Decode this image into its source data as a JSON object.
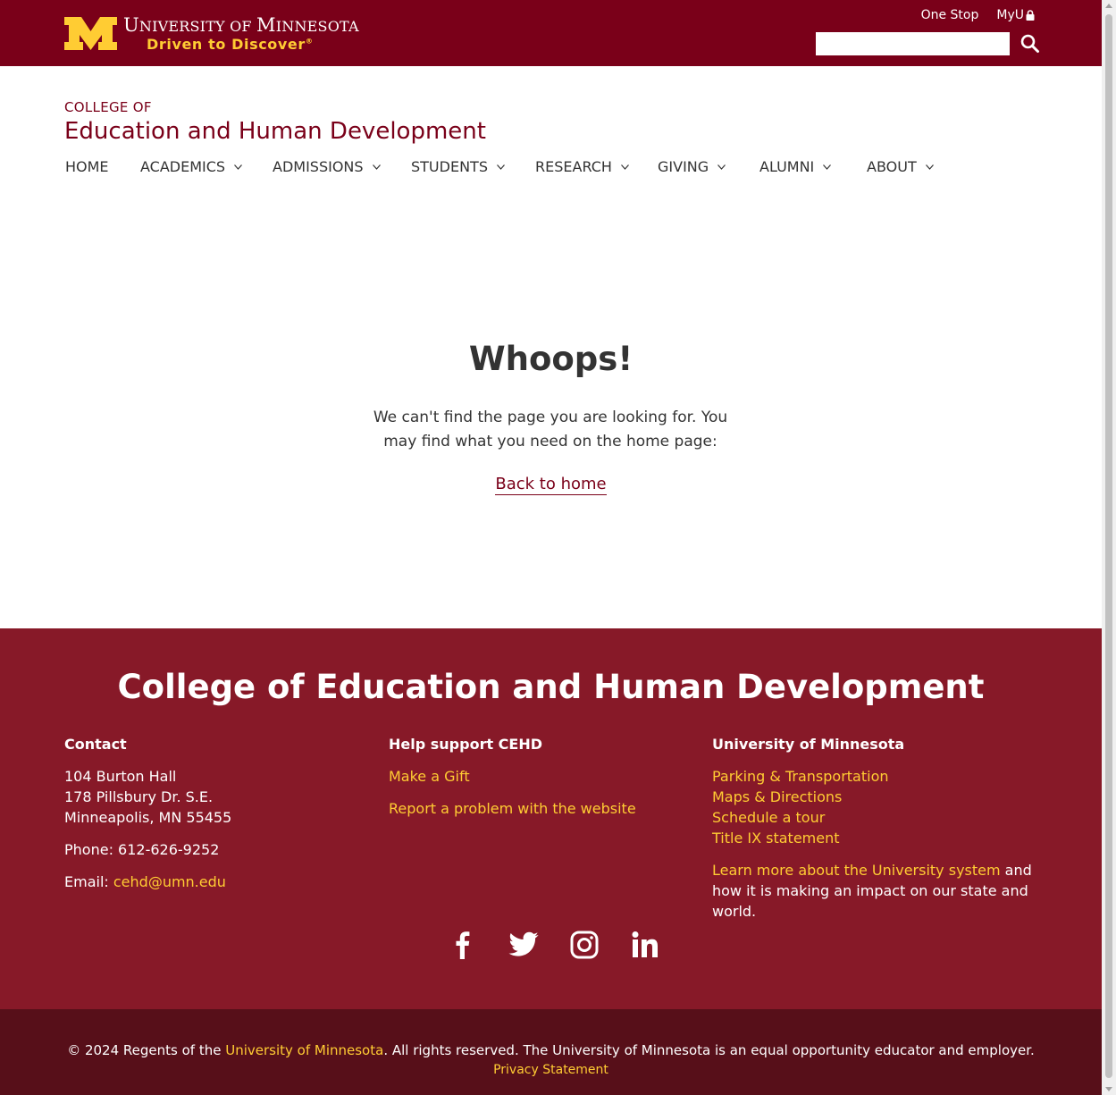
{
  "header": {
    "university_name": "UNIVERSITY OF MINNESOTA",
    "university_name_display": "University of Minnesota",
    "tagline": "Driven to Discover",
    "tagline_mark": "®",
    "links": {
      "one_stop": "One Stop",
      "myu": "MyU"
    },
    "search": {
      "placeholder": ""
    }
  },
  "college": {
    "prefix": "COLLEGE OF",
    "name": "Education and Human Development"
  },
  "nav": [
    {
      "label": "HOME",
      "has_menu": false
    },
    {
      "label": "ACADEMICS",
      "has_menu": true
    },
    {
      "label": "ADMISSIONS",
      "has_menu": true
    },
    {
      "label": "STUDENTS",
      "has_menu": true
    },
    {
      "label": "RESEARCH",
      "has_menu": true
    },
    {
      "label": "GIVING",
      "has_menu": true
    },
    {
      "label": "ALUMNI",
      "has_menu": true
    },
    {
      "label": "ABOUT",
      "has_menu": true
    }
  ],
  "error": {
    "title": "Whoops!",
    "message": "We can't find the page you are looking for. You may find what you need on the home page:",
    "link": "Back to home"
  },
  "footer": {
    "title": "College of Education and Human Development",
    "contact": {
      "heading": "Contact",
      "address1": "104 Burton Hall",
      "address2": "178 Pillsbury Dr. S.E.",
      "address3": "Minneapolis, MN 55455",
      "phone": "Phone: 612-626-9252",
      "email_label": "Email: ",
      "email": "cehd@umn.edu"
    },
    "support": {
      "heading": "Help support CEHD",
      "gift": "Make a Gift",
      "report": "Report a problem with the website"
    },
    "umn": {
      "heading": "University of Minnesota",
      "links": [
        "Parking & Transportation",
        "Maps & Directions",
        "Schedule a tour",
        "Title IX statement"
      ],
      "learn_link": "Learn more about the University system",
      "learn_rest": " and how it is making an impact on our state and world."
    },
    "social": [
      "facebook-icon",
      "twitter-icon",
      "instagram-icon",
      "linkedin-icon"
    ]
  },
  "bottom": {
    "copy_pre": "© 2024 Regents of the ",
    "copy_link": "University of Minnesota",
    "copy_post": ". All rights reserved. The University of Minnesota is an equal opportunity educator and employer.",
    "privacy": "Privacy Statement"
  },
  "colors": {
    "maroon": "#7a0019",
    "footer": "#871928",
    "bottom": "#570f19",
    "gold": "#ffcc33"
  }
}
